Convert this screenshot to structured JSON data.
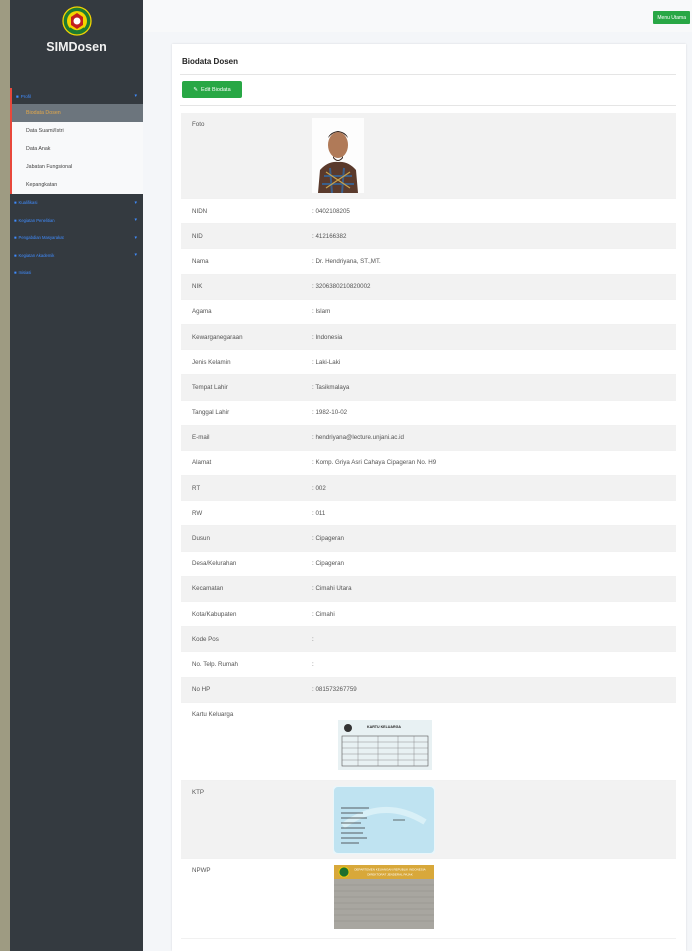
{
  "sidebar": {
    "brand": "SIMDosen",
    "profil_label": "Profil",
    "sub_items": [
      "Biodata Dosen",
      "Data Suami/Istri",
      "Data Anak",
      "Jabatan Fungsional",
      "Kepangkatan"
    ],
    "active_index": 0,
    "nav_items": [
      {
        "label": "Kualifikasi",
        "has_caret": true
      },
      {
        "label": "Kegiatan Penelitian",
        "has_caret": true
      },
      {
        "label": "Pengabdian Masyarakat",
        "has_caret": true
      },
      {
        "label": "Kegiatan Akademik",
        "has_caret": true
      },
      {
        "label": "Inisiasi",
        "has_caret": false
      }
    ]
  },
  "header": {
    "menu_utama": "Menu Utama"
  },
  "card": {
    "title": "Biodata Dosen",
    "edit_label": "Edit Biodata"
  },
  "fields": [
    {
      "label": "NIDN",
      "value": ": 0402108205"
    },
    {
      "label": "NID",
      "value": ": 412166382"
    },
    {
      "label": "Nama",
      "value": ": Dr. Hendriyana, ST.,MT."
    },
    {
      "label": "NIK",
      "value": ": 3206380210820002"
    },
    {
      "label": "Agama",
      "value": ": Islam"
    },
    {
      "label": "Kewarganegaraan",
      "value": ": Indonesia"
    },
    {
      "label": "Jenis Kelamin",
      "value": ": Laki-Laki"
    },
    {
      "label": "Tempat Lahir",
      "value": ": Tasikmalaya"
    },
    {
      "label": "Tanggal Lahir",
      "value": ": 1982-10-02"
    },
    {
      "label": "E-mail",
      "value": ": hendriyana@lecture.unjani.ac.id"
    },
    {
      "label": "Alamat",
      "value": ": Komp. Griya Asri Cahaya Cipageran No. H9"
    },
    {
      "label": "RT",
      "value": ": 002"
    },
    {
      "label": "RW",
      "value": ": 011"
    },
    {
      "label": "Dusun",
      "value": ": Cipageran"
    },
    {
      "label": "Desa/Kelurahan",
      "value": ": Cipageran"
    },
    {
      "label": "Kecamatan",
      "value": ": Cimahi Utara"
    },
    {
      "label": "Kota/Kabupaten",
      "value": ": Cimahi"
    },
    {
      "label": "Kode Pos",
      "value": ":"
    },
    {
      "label": "No. Telp. Rumah",
      "value": ":"
    },
    {
      "label": "No HP",
      "value": ": 081573267759"
    }
  ],
  "labels": {
    "foto": "Foto",
    "kartu_keluarga": "Kartu Keluarga",
    "ktp": "KTP",
    "npwp": "NPWP"
  },
  "images": {
    "kk_title": "KARTU KELUARGA",
    "npwp_header_1": "DEPARTEMEN KEUANGAN REPUBLIK INDONESIA",
    "npwp_header_2": "DIREKTORAT JENDERAL PAJAK"
  },
  "colors": {
    "sidebar_bg": "#343a40",
    "accent_blue": "#3f8cff",
    "active_text": "#e3a84a",
    "green_button": "#28a745",
    "outer_bg": "#9e9b82"
  }
}
